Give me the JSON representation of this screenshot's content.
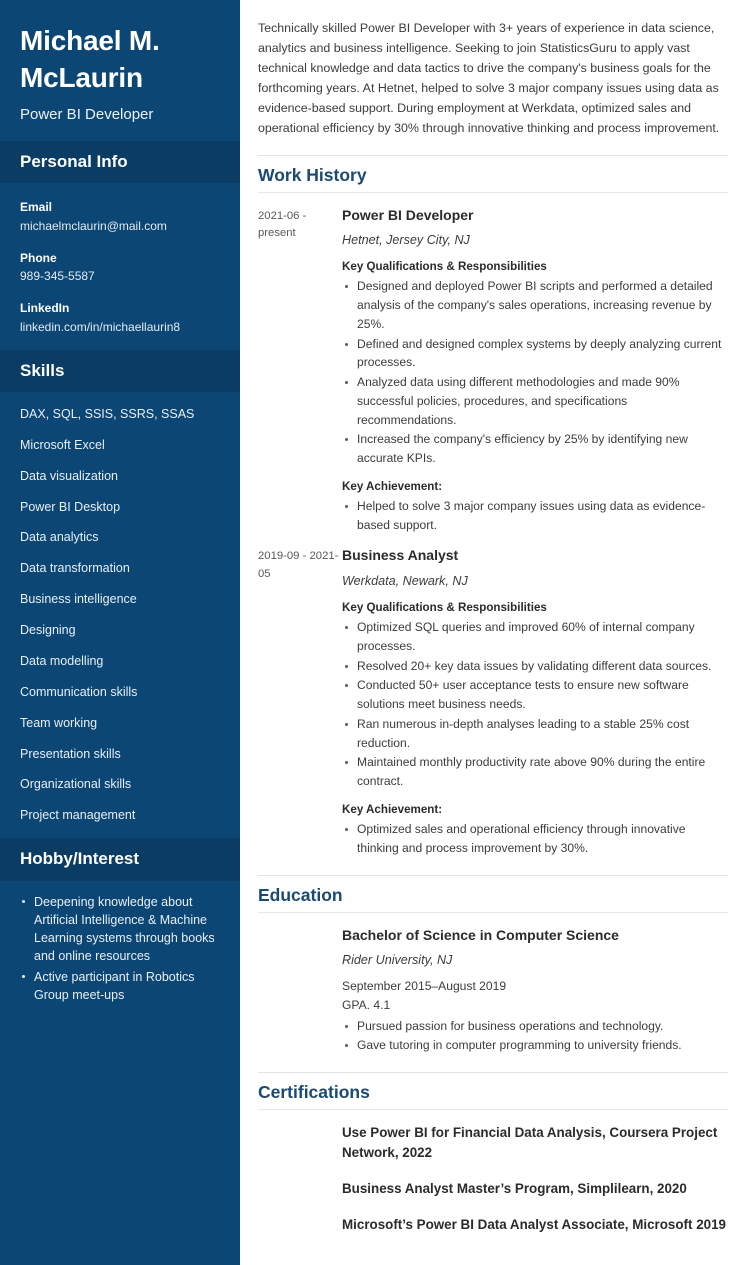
{
  "sidebar": {
    "name": "Michael M. McLaurin",
    "job_title": "Power BI Developer",
    "personal_info": {
      "heading": "Personal Info",
      "items": [
        {
          "label": "Email",
          "value": "michaelmclaurin@mail.com"
        },
        {
          "label": "Phone",
          "value": "989-345-5587"
        },
        {
          "label": "LinkedIn",
          "value": "linkedin.com/in/michaellaurin8"
        }
      ]
    },
    "skills": {
      "heading": "Skills",
      "items": [
        "DAX, SQL, SSIS, SSRS, SSAS",
        "Microsoft Excel",
        "Data visualization",
        "Power BI Desktop",
        "Data analytics",
        "Data transformation",
        "Business intelligence",
        "Designing",
        "Data modelling",
        "Communication skills",
        "Team working",
        "Presentation skills",
        "Organizational skills",
        "Project management"
      ]
    },
    "hobby": {
      "heading": "Hobby/Interest",
      "items": [
        "Deepening knowledge about Artificial Intelligence & Machine Learning systems through books and online resources",
        "Active participant in Robotics Group meet-ups"
      ]
    }
  },
  "main": {
    "summary": "Technically skilled Power BI Developer with 3+ years of experience in data science, analytics and business intelligence. Seeking to join StatisticsGuru to apply vast technical knowledge and data tactics to drive the company's business goals for the forthcoming years. At Hetnet, helped to solve 3 major company issues using data as evidence-based support. During employment at Werkdata, optimized sales and operational efficiency by 30% through innovative thinking and process improvement.",
    "work_history": {
      "heading": "Work History",
      "entries": [
        {
          "dates": "2021-06 - present",
          "title": "Power BI Developer",
          "org": "Hetnet, Jersey City, NJ",
          "qualifications_label": "Key Qualifications & Responsibilities",
          "qualifications": [
            "Designed and deployed Power BI scripts and performed a detailed analysis of the company's sales operations, increasing revenue by 25%.",
            "Defined and designed complex systems by deeply analyzing current processes.",
            "Analyzed data using different methodologies and made 90% successful policies, procedures, and specifications recommendations.",
            "Increased the company's efficiency by 25% by identifying new accurate KPIs."
          ],
          "achievement_label": "Key Achievement:",
          "achievements": [
            "Helped to solve 3 major company issues using data as evidence-based support."
          ]
        },
        {
          "dates": "2019-09 - 2021-05",
          "title": "Business Analyst",
          "org": "Werkdata, Newark, NJ",
          "qualifications_label": "Key Qualifications & Responsibilities",
          "qualifications": [
            "Optimized SQL queries and improved 60% of internal company processes.",
            "Resolved 20+ key data issues by validating different data sources.",
            "Conducted 50+ user acceptance tests to ensure new software solutions meet business needs.",
            "Ran numerous in-depth analyses leading to a stable 25% cost reduction.",
            "Maintained monthly productivity rate above 90% during the entire contract."
          ],
          "achievement_label": "Key Achievement:",
          "achievements": [
            "Optimized sales and operational efficiency through innovative thinking and process improvement by 30%."
          ]
        }
      ]
    },
    "education": {
      "heading": "Education",
      "entries": [
        {
          "degree": "Bachelor of Science in Computer Science",
          "school": "Rider University, NJ",
          "dates": "September 2015–August 2019",
          "gpa": "GPA. 4.1",
          "bullets": [
            "Pursued passion for business operations and technology.",
            "Gave tutoring in computer programming to university friends."
          ]
        }
      ]
    },
    "certifications": {
      "heading": "Certifications",
      "entries": [
        "Use Power BI for Financial Data Analysis, Coursera Project Network, 2022",
        "Business Analyst Master’s Program, Simplilearn, 2020",
        "Microsoft’s Power BI Data Analyst Associate, Microsoft 2019"
      ]
    }
  }
}
